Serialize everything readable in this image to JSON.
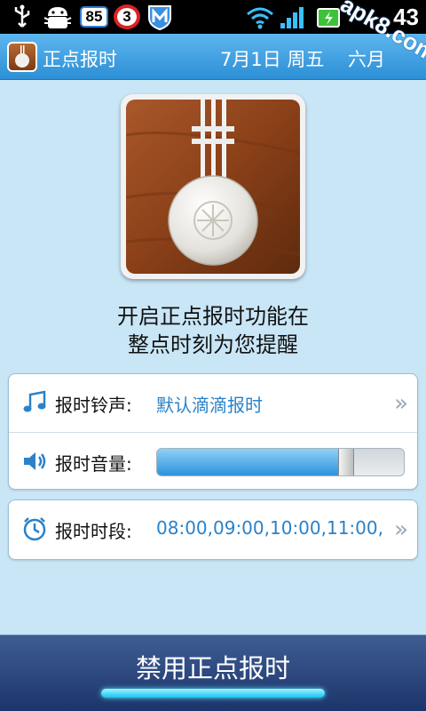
{
  "status_bar": {
    "badge_count": "85",
    "notification_count": "3",
    "time": "43",
    "icons": [
      "usb-icon",
      "android-debug-icon",
      "m-shield-icon",
      "wifi-icon",
      "signal-icon",
      "battery-charging-icon"
    ]
  },
  "header": {
    "app_title": "正点报时",
    "date": "7月1日 周五",
    "lunar_date": "六月",
    "watermark": "apk8.com"
  },
  "description": {
    "line1": "开启正点报时功能在",
    "line2": "整点时刻为您提醒"
  },
  "settings": {
    "ringtone_label": "报时铃声:",
    "ringtone_value": "默认滴滴报时",
    "volume_label": "报时音量:",
    "volume_level": 0.78,
    "period_label": "报时时段:",
    "period_value": "08:00,09:00,10:00,11:00,...",
    "chevron": "»"
  },
  "bottom": {
    "disable_label": "禁用正点报时"
  },
  "colors": {
    "accent_blue": "#2a82c9",
    "title_bar": "#2c8fd6",
    "background": "#c9e6f7",
    "bottom_bar": "#1c356a"
  }
}
